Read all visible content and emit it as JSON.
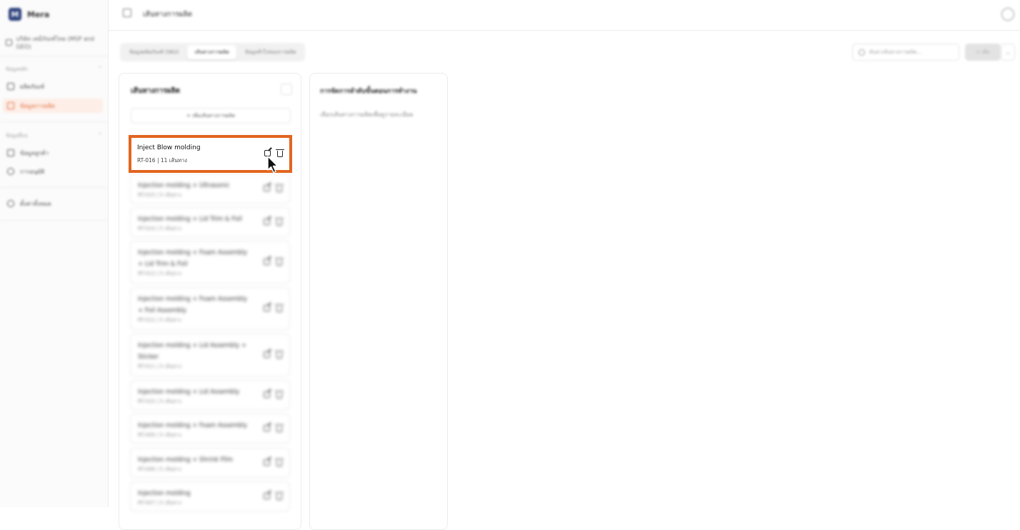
{
  "app": {
    "name": "Mera"
  },
  "sidebar": {
    "company": "บริษัท เคมีภัณฑ์ไทย (MSP and GEO)",
    "groups": [
      {
        "label": "ข้อมูลหลัก",
        "items": [
          {
            "label": "ผลิตภัณฑ์"
          },
          {
            "label": "ข้อมูลการผลิต"
          }
        ]
      },
      {
        "label": "ข้อมูลอื่นๆ",
        "items": [
          {
            "label": "ข้อมูลลูกค้า"
          },
          {
            "label": "การอนุมัติ"
          }
        ]
      }
    ],
    "footer_item": "ตั้งค่าทั้งหมด"
  },
  "header": {
    "title": "เส้นทางการผลิต"
  },
  "tabs": [
    {
      "label": "ข้อมูลผลิตภัณฑ์ (SKU)"
    },
    {
      "label": "เส้นทางการผลิต"
    },
    {
      "label": "ข้อมูลทั่วไปของการผลิต"
    }
  ],
  "search": {
    "placeholder": "ค้นหาเส้นทางการผลิต..."
  },
  "add_button": {
    "label": "+ เพิ่ม"
  },
  "left_panel": {
    "title": "เส้นทางการผลิต",
    "add_route_label": "+ เพิ่มเส้นทางการผลิต"
  },
  "right_panel": {
    "title": "การจัดการลำดับขั้นตอนการทำงาน",
    "hint": "เลือกเส้นทางการผลิตเพื่อดูรายละเอียด"
  },
  "highlighted_route": {
    "name": "Inject Blow molding",
    "meta": "RT-016 | 11 เส้นทาง"
  },
  "routes": [
    {
      "name": "Injection molding + Ultrasonic",
      "meta": "RT-015 | 5 เส้นทาง"
    },
    {
      "name": "Injection molding + Lid Trim & Foil",
      "meta": "RT-014 | 5 เส้นทาง"
    },
    {
      "name": "Injection molding + Foam Assembly + Lid Trim & Foil",
      "meta": "RT-013 | 5 เส้นทาง"
    },
    {
      "name": "Injection molding + Foam Assembly + Foil Assembly",
      "meta": "RT-012 | 5 เส้นทาง"
    },
    {
      "name": "Injection molding + Lid Assembly + Sticker",
      "meta": "RT-011 | 5 เส้นทาง"
    },
    {
      "name": "Injection molding + Lid Assembly",
      "meta": "RT-010 | 5 เส้นทาง"
    },
    {
      "name": "Injection molding + Foam Assembly",
      "meta": "RT-009 | 5 เส้นทาง"
    },
    {
      "name": "Injection molding + Shrink Film",
      "meta": "RT-008 | 5 เส้นทาง"
    },
    {
      "name": "Injection molding",
      "meta": "RT-007 | 5 เส้นทาง"
    }
  ]
}
